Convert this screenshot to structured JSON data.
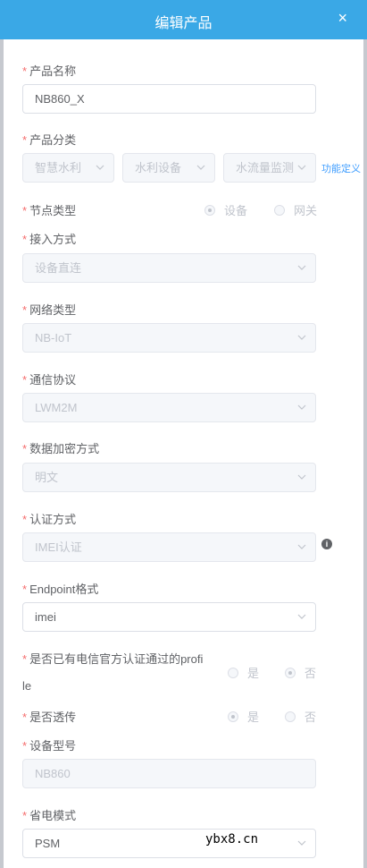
{
  "dialog": {
    "title": "编辑产品",
    "close_icon": "×"
  },
  "product_name": {
    "label": "产品名称",
    "value": "NB860_X"
  },
  "category": {
    "label": "产品分类",
    "values": [
      "智慧水利",
      "水利设备",
      "水流量监测"
    ],
    "link": "功能定义"
  },
  "node_type": {
    "label": "节点类型",
    "options": [
      "设备",
      "网关"
    ],
    "selected": "设备"
  },
  "access_mode": {
    "label": "接入方式",
    "value": "设备直连"
  },
  "network_type": {
    "label": "网络类型",
    "value": "NB-IoT"
  },
  "protocol": {
    "label": "通信协议",
    "value": "LWM2M"
  },
  "encryption": {
    "label": "数据加密方式",
    "value": "明文"
  },
  "auth": {
    "label": "认证方式",
    "value": "IMEI认证",
    "info_icon": "i"
  },
  "endpoint": {
    "label": "Endpoint格式",
    "value": "imei"
  },
  "profile": {
    "label_line1": "是否已有电信官方认证通过的profi",
    "label_line2": "le",
    "options": [
      "是",
      "否"
    ],
    "selected": "否"
  },
  "passthrough": {
    "label": "是否透传",
    "options": [
      "是",
      "否"
    ],
    "selected": "是"
  },
  "device_model": {
    "label": "设备型号",
    "value": "NB860"
  },
  "power_mode": {
    "label": "省电模式",
    "value": "PSM"
  },
  "watermark": "ybx8.cn",
  "colors": {
    "header": "#3aa8e6",
    "required": "#f56c6c",
    "link": "#409eff"
  }
}
